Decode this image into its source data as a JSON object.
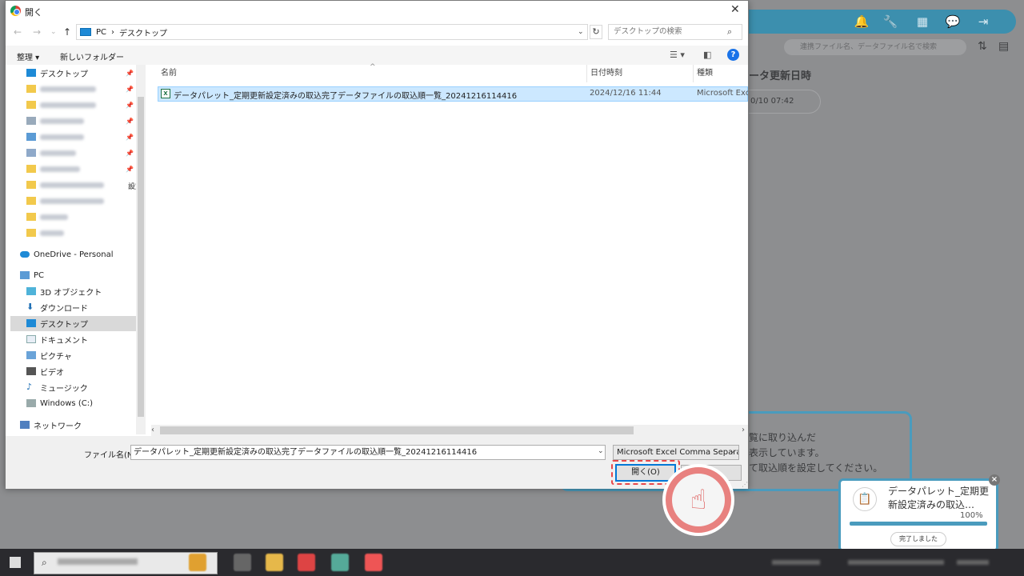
{
  "dialog": {
    "title": "開く",
    "close": "✕",
    "nav": {
      "back": "←",
      "forward": "→",
      "history": "⌄",
      "up": "↑"
    },
    "breadcrumb": [
      "PC",
      "デスクトップ"
    ],
    "search_placeholder": "デスクトップの検索",
    "toolbar": {
      "organize": "整理 ▾",
      "new_folder": "新しいフォルダー"
    },
    "help": "?"
  },
  "sidebar": {
    "quick_access": [
      {
        "label": "デスクトップ",
        "pinned": true
      },
      {
        "label": "",
        "pinned": true
      },
      {
        "label": "",
        "pinned": true
      },
      {
        "label": "",
        "pinned": true
      },
      {
        "label": "",
        "pinned": true
      },
      {
        "label": "",
        "pinned": true
      },
      {
        "label": "",
        "pinned": true
      },
      {
        "label": "",
        "pinned": false,
        "note": "設定"
      },
      {
        "label": "",
        "pinned": false
      },
      {
        "label": "",
        "pinned": false
      },
      {
        "label": "",
        "pinned": false
      }
    ],
    "onedrive": "OneDrive - Personal",
    "pc": "PC",
    "pc_items": [
      "3D オブジェクト",
      "ダウンロード",
      "デスクトップ",
      "ドキュメント",
      "ピクチャ",
      "ビデオ",
      "ミュージック",
      "Windows (C:)"
    ],
    "network": "ネットワーク"
  },
  "columns": {
    "name": "名前",
    "date": "日付時刻",
    "type": "種類"
  },
  "files": [
    {
      "name": "データパレット_定期更新設定済みの取込完了データファイルの取込順一覧_20241216114416",
      "date": "2024/12/16 11:44",
      "type": "Microsoft Excel",
      "icon": "excel-csv-icon"
    }
  ],
  "footer": {
    "filename_label": "ファイル名(N):",
    "filename_value": "データパレット_定期更新設定済みの取込完了データファイルの取込順一覧_20241216114416",
    "filetype": "Microsoft Excel Comma Separa",
    "open_button": "開く(O)",
    "cancel_button": ""
  },
  "background": {
    "search_placeholder": "連携ファイル名、データファイル名で検索",
    "column_header": "ータ更新日時",
    "date_value": "0/10 07:42",
    "info_lines": [
      "覧に取り込んだ",
      "表示しています。",
      "て取込順を設定してください。"
    ]
  },
  "toast": {
    "title": "データパレット_定期更新設定済みの取込…",
    "progress": 100,
    "progress_label": "100%",
    "button": "完了しました",
    "close": "×"
  },
  "colors": {
    "accent": "#0078d7",
    "selection": "#cce8ff",
    "app_header": "#3c8fae",
    "highlight": "#e8484a"
  }
}
